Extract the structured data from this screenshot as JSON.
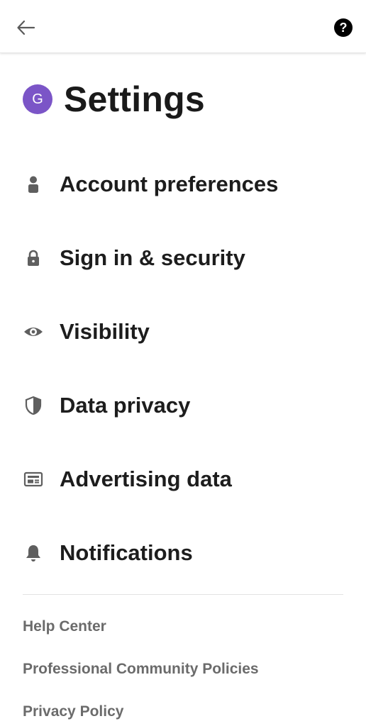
{
  "header": {
    "avatar_letter": "G",
    "title": "Settings"
  },
  "menu": {
    "items": [
      {
        "label": "Account preferences",
        "icon": "person-icon"
      },
      {
        "label": "Sign in & security",
        "icon": "lock-icon"
      },
      {
        "label": "Visibility",
        "icon": "eye-icon"
      },
      {
        "label": "Data privacy",
        "icon": "shield-icon"
      },
      {
        "label": "Advertising data",
        "icon": "ad-card-icon"
      },
      {
        "label": "Notifications",
        "icon": "bell-icon"
      }
    ]
  },
  "footer": {
    "links": [
      {
        "label": "Help Center"
      },
      {
        "label": "Professional Community Policies"
      },
      {
        "label": "Privacy Policy"
      }
    ]
  },
  "colors": {
    "avatar_bg": "#7b55c7",
    "icon": "#5f5f5f",
    "text_primary": "#1d1d1d",
    "text_secondary": "#6b6b6b"
  }
}
